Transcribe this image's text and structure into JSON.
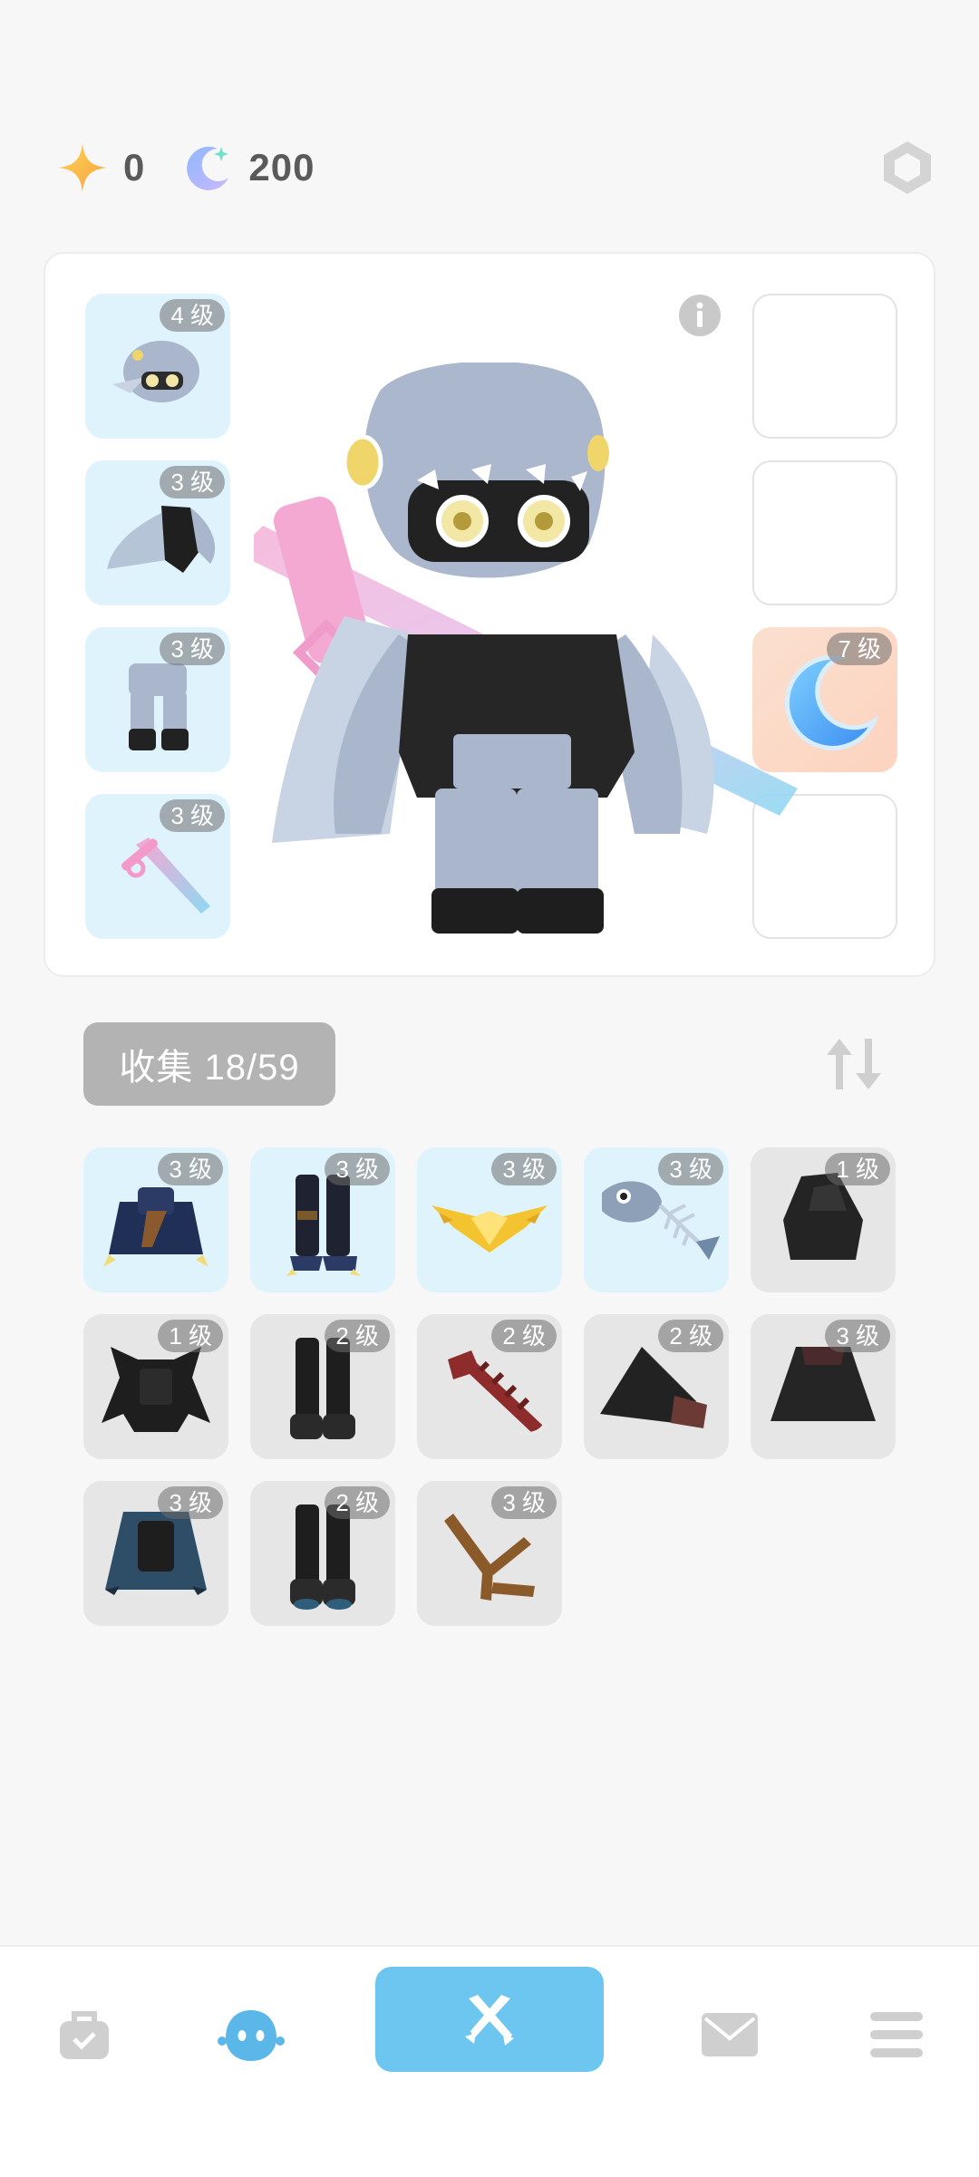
{
  "currency": {
    "stars": "0",
    "moons": "200"
  },
  "equipped": {
    "left": [
      {
        "level": "4 级",
        "icon": "helmet-icon"
      },
      {
        "level": "3 级",
        "icon": "wings-top-icon"
      },
      {
        "level": "3 级",
        "icon": "pants-icon"
      },
      {
        "level": "3 级",
        "icon": "sword-icon"
      }
    ],
    "right": [
      {
        "level": "",
        "icon": ""
      },
      {
        "level": "",
        "icon": ""
      },
      {
        "level": "7 级",
        "icon": "moon-icon"
      },
      {
        "level": "",
        "icon": ""
      }
    ]
  },
  "collection": {
    "label": "收集 18/59"
  },
  "items": [
    {
      "level": "3 级",
      "icon": "dark-armor-icon",
      "bg": "blue"
    },
    {
      "level": "3 级",
      "icon": "dark-boots-icon",
      "bg": "blue"
    },
    {
      "level": "3 级",
      "icon": "golden-wings-icon",
      "bg": "blue"
    },
    {
      "level": "3 级",
      "icon": "fish-bone-icon",
      "bg": "blue"
    },
    {
      "level": "1 级",
      "icon": "black-hood-icon",
      "bg": "gray"
    },
    {
      "level": "1 级",
      "icon": "dark-spiked-armor-icon",
      "bg": "gray"
    },
    {
      "level": "2 级",
      "icon": "black-boots-icon",
      "bg": "gray"
    },
    {
      "level": "2 级",
      "icon": "red-blade-icon",
      "bg": "gray"
    },
    {
      "level": "2 级",
      "icon": "witch-hat-icon",
      "bg": "gray"
    },
    {
      "level": "3 级",
      "icon": "black-cloak-icon",
      "bg": "gray"
    },
    {
      "level": "3 级",
      "icon": "teal-cloak-icon",
      "bg": "gray"
    },
    {
      "level": "2 级",
      "icon": "teal-boots-icon",
      "bg": "gray"
    },
    {
      "level": "3 级",
      "icon": "wooden-branch-icon",
      "bg": "gray"
    }
  ],
  "nav": {
    "items": [
      "bag-icon",
      "character-icon",
      "battle-icon",
      "mail-icon",
      "menu-icon"
    ],
    "active": "character-icon"
  },
  "colors": {
    "accent": "#6cc6ef",
    "slot_blue": "#dff3fd",
    "slot_gray": "#e6e6e6",
    "badge": "#8a8a8a"
  }
}
